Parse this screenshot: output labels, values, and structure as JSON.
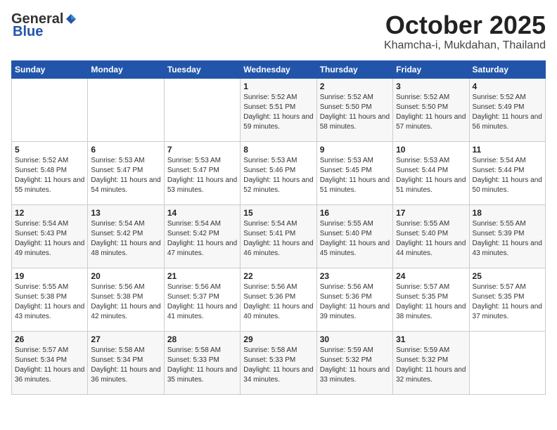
{
  "logo": {
    "general": "General",
    "blue": "Blue"
  },
  "header": {
    "month": "October 2025",
    "location": "Khamcha-i, Mukdahan, Thailand"
  },
  "days_of_week": [
    "Sunday",
    "Monday",
    "Tuesday",
    "Wednesday",
    "Thursday",
    "Friday",
    "Saturday"
  ],
  "weeks": [
    [
      {
        "day": "",
        "info": ""
      },
      {
        "day": "",
        "info": ""
      },
      {
        "day": "",
        "info": ""
      },
      {
        "day": "1",
        "info": "Sunrise: 5:52 AM\nSunset: 5:51 PM\nDaylight: 11 hours and 59 minutes."
      },
      {
        "day": "2",
        "info": "Sunrise: 5:52 AM\nSunset: 5:50 PM\nDaylight: 11 hours and 58 minutes."
      },
      {
        "day": "3",
        "info": "Sunrise: 5:52 AM\nSunset: 5:50 PM\nDaylight: 11 hours and 57 minutes."
      },
      {
        "day": "4",
        "info": "Sunrise: 5:52 AM\nSunset: 5:49 PM\nDaylight: 11 hours and 56 minutes."
      }
    ],
    [
      {
        "day": "5",
        "info": "Sunrise: 5:52 AM\nSunset: 5:48 PM\nDaylight: 11 hours and 55 minutes."
      },
      {
        "day": "6",
        "info": "Sunrise: 5:53 AM\nSunset: 5:47 PM\nDaylight: 11 hours and 54 minutes."
      },
      {
        "day": "7",
        "info": "Sunrise: 5:53 AM\nSunset: 5:47 PM\nDaylight: 11 hours and 53 minutes."
      },
      {
        "day": "8",
        "info": "Sunrise: 5:53 AM\nSunset: 5:46 PM\nDaylight: 11 hours and 52 minutes."
      },
      {
        "day": "9",
        "info": "Sunrise: 5:53 AM\nSunset: 5:45 PM\nDaylight: 11 hours and 51 minutes."
      },
      {
        "day": "10",
        "info": "Sunrise: 5:53 AM\nSunset: 5:44 PM\nDaylight: 11 hours and 51 minutes."
      },
      {
        "day": "11",
        "info": "Sunrise: 5:54 AM\nSunset: 5:44 PM\nDaylight: 11 hours and 50 minutes."
      }
    ],
    [
      {
        "day": "12",
        "info": "Sunrise: 5:54 AM\nSunset: 5:43 PM\nDaylight: 11 hours and 49 minutes."
      },
      {
        "day": "13",
        "info": "Sunrise: 5:54 AM\nSunset: 5:42 PM\nDaylight: 11 hours and 48 minutes."
      },
      {
        "day": "14",
        "info": "Sunrise: 5:54 AM\nSunset: 5:42 PM\nDaylight: 11 hours and 47 minutes."
      },
      {
        "day": "15",
        "info": "Sunrise: 5:54 AM\nSunset: 5:41 PM\nDaylight: 11 hours and 46 minutes."
      },
      {
        "day": "16",
        "info": "Sunrise: 5:55 AM\nSunset: 5:40 PM\nDaylight: 11 hours and 45 minutes."
      },
      {
        "day": "17",
        "info": "Sunrise: 5:55 AM\nSunset: 5:40 PM\nDaylight: 11 hours and 44 minutes."
      },
      {
        "day": "18",
        "info": "Sunrise: 5:55 AM\nSunset: 5:39 PM\nDaylight: 11 hours and 43 minutes."
      }
    ],
    [
      {
        "day": "19",
        "info": "Sunrise: 5:55 AM\nSunset: 5:38 PM\nDaylight: 11 hours and 43 minutes."
      },
      {
        "day": "20",
        "info": "Sunrise: 5:56 AM\nSunset: 5:38 PM\nDaylight: 11 hours and 42 minutes."
      },
      {
        "day": "21",
        "info": "Sunrise: 5:56 AM\nSunset: 5:37 PM\nDaylight: 11 hours and 41 minutes."
      },
      {
        "day": "22",
        "info": "Sunrise: 5:56 AM\nSunset: 5:36 PM\nDaylight: 11 hours and 40 minutes."
      },
      {
        "day": "23",
        "info": "Sunrise: 5:56 AM\nSunset: 5:36 PM\nDaylight: 11 hours and 39 minutes."
      },
      {
        "day": "24",
        "info": "Sunrise: 5:57 AM\nSunset: 5:35 PM\nDaylight: 11 hours and 38 minutes."
      },
      {
        "day": "25",
        "info": "Sunrise: 5:57 AM\nSunset: 5:35 PM\nDaylight: 11 hours and 37 minutes."
      }
    ],
    [
      {
        "day": "26",
        "info": "Sunrise: 5:57 AM\nSunset: 5:34 PM\nDaylight: 11 hours and 36 minutes."
      },
      {
        "day": "27",
        "info": "Sunrise: 5:58 AM\nSunset: 5:34 PM\nDaylight: 11 hours and 36 minutes."
      },
      {
        "day": "28",
        "info": "Sunrise: 5:58 AM\nSunset: 5:33 PM\nDaylight: 11 hours and 35 minutes."
      },
      {
        "day": "29",
        "info": "Sunrise: 5:58 AM\nSunset: 5:33 PM\nDaylight: 11 hours and 34 minutes."
      },
      {
        "day": "30",
        "info": "Sunrise: 5:59 AM\nSunset: 5:32 PM\nDaylight: 11 hours and 33 minutes."
      },
      {
        "day": "31",
        "info": "Sunrise: 5:59 AM\nSunset: 5:32 PM\nDaylight: 11 hours and 32 minutes."
      },
      {
        "day": "",
        "info": ""
      }
    ]
  ]
}
